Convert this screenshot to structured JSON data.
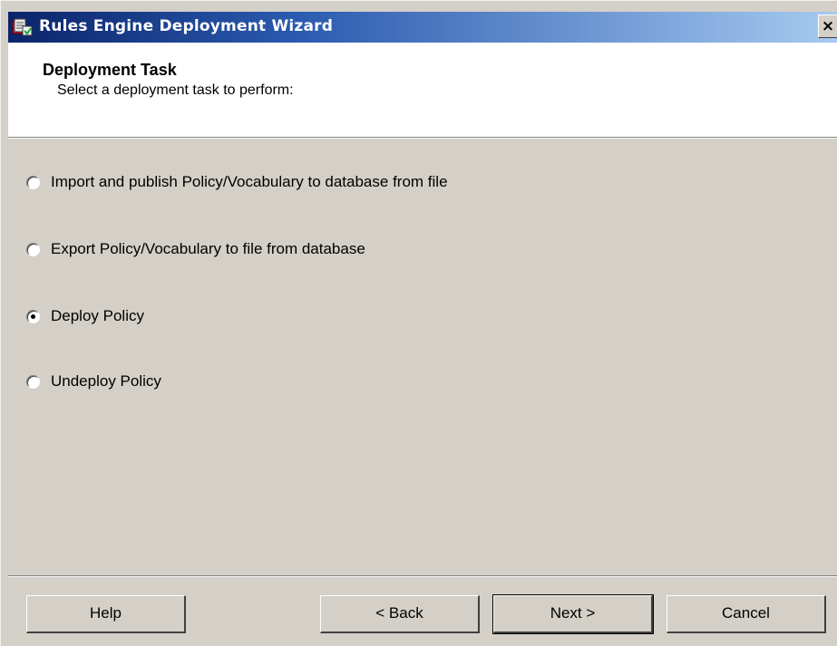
{
  "window": {
    "title": "Rules Engine Deployment Wizard",
    "close_glyph": "×",
    "icon": "rules-engine-app-icon"
  },
  "header": {
    "title": "Deployment Task",
    "subtitle": "Select a deployment task to perform:"
  },
  "options": [
    {
      "label": "Import and publish Policy/Vocabulary to database from file",
      "selected": false
    },
    {
      "label": "Export Policy/Vocabulary to file from database",
      "selected": false
    },
    {
      "label": "Deploy Policy",
      "selected": true
    },
    {
      "label": "Undeploy Policy",
      "selected": false
    }
  ],
  "buttons": {
    "help": "Help",
    "back": "< Back",
    "next": "Next >",
    "cancel": "Cancel"
  },
  "colors": {
    "dialog_bg": "#d4d0c8",
    "titlebar_start": "#0a246a",
    "titlebar_end": "#a6caf0",
    "header_bg": "#ffffff"
  }
}
